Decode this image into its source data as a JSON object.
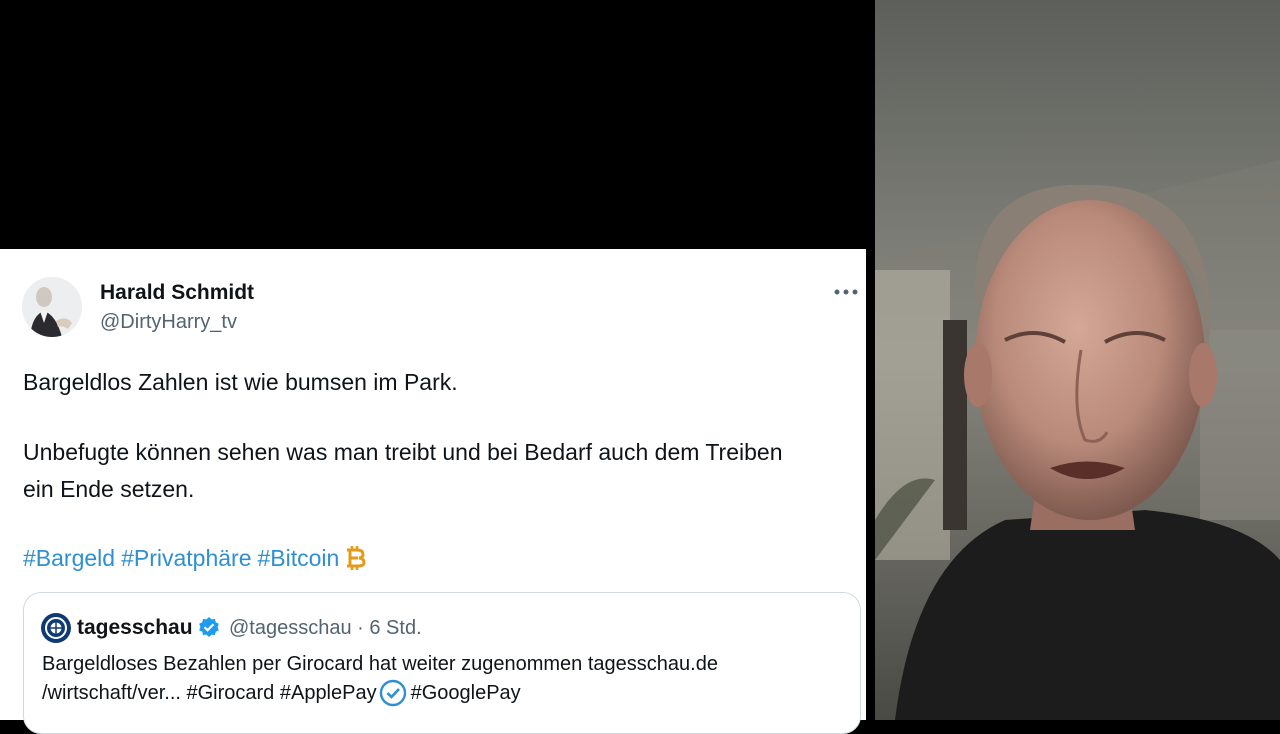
{
  "tweet": {
    "author_name": "Harald Schmidt",
    "author_handle": "@DirtyHarry_tv",
    "more_icon": "more-horizontal-icon",
    "line1": "Bargeldlos Zahlen ist wie bumsen im Park.",
    "line2": "Unbefugte können sehen was man treibt und bei Bedarf auch dem Treiben",
    "line3": "ein Ende setzen.",
    "hashtags": [
      "#Bargeld",
      "#Privatphäre",
      "#Bitcoin"
    ],
    "emoji": "bitcoin-emoji-icon"
  },
  "quoted": {
    "name": "tagesschau",
    "handle_time": "@tagesschau · 6 Std.",
    "line1": "Bargeldloses Bezahlen per Girocard hat weiter zugenommen tagesschau.de",
    "line2_a": "/wirtschaft/ver... #Girocard #ApplePay",
    "line2_b": "#GooglePay"
  },
  "colors": {
    "hashtag": "#2f8fd0",
    "verified": "#1d9bf0",
    "text": "#0f1419",
    "muted": "#536471"
  }
}
